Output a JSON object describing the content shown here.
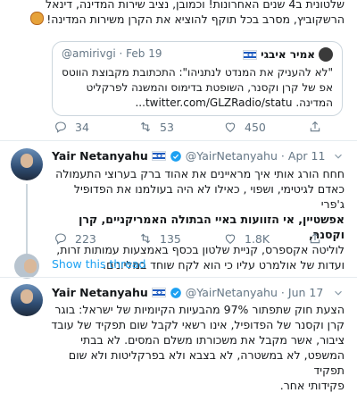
{
  "top_tweet": {
    "line1": "שלטונית ב4 שנים האחרונות! וכמובן, נציב שירות המדינה, דינאל",
    "line2": "הרשקוביץ, מסרב בכל תוקף להוציא את הקרן משירות המדינה!",
    "emoji": "angry-face"
  },
  "quote": {
    "name": "אמיר איבגי",
    "handle": "@amirivgi",
    "date": "Feb 19",
    "line1": "\"לא להעניק את המנדט לנתניהו\": התכתובת מקבוצת הווטס",
    "line2": "אפ של קרן וקסנר, השופטת בדימוס והמשנה לפרקליט",
    "line3": "המדינה. twitter.com/GLZRadio/statu..."
  },
  "tweet1_actions": {
    "replies": "34",
    "retweets": "53",
    "likes": "450"
  },
  "tweet2": {
    "name": "Yair Netanyahu",
    "handle": "@YairNetanyahu",
    "date": "Apr 11",
    "line1": "חחח הורג אותי איך מראיינים את אהוד ברק בערוצי התעמולה",
    "line2": "כאדם לגיטימי, ושפוי , כאילו לא היה בעולמנו את  הפדופיל ג'פרי",
    "line3": "אפשטיין, אי הזוועות באיי הבתולה האמריקניים, קרן וקסנר,",
    "line4": "לוליטה אקספרס, קניית שלטון בכסף באמצעות עמותות זרות,",
    "line5": "ועדות של אולמרט עליו כי הוא לקח שוחד במליונים.",
    "replies": "223",
    "retweets": "135",
    "likes": "1.8K",
    "show_thread": "Show this thread"
  },
  "tweet3": {
    "name": "Yair Netanyahu",
    "handle": "@YairNetanyahu",
    "date": "Jun 17",
    "line1": "הצעת חוק שתפתור 97% מהבעיות הקיומיות של ישראל: בוגר",
    "line2": "קרן וקסנר של הפדופיל, אינו רשאי לקבל שום תפקיד של עובד",
    "line3": "ציבור, אשר מקבל את משכורתו משלם המסים. לא בבתי",
    "line4": "המשפט, לא במשטרה, לא בצבא ולא בפרקליטות ולא שום תפקיד",
    "line5": "פקידותי אחר."
  },
  "colors": {
    "link": "#1da1f2",
    "muted": "#657786",
    "like": "#e0245e",
    "text": "#14171a"
  }
}
